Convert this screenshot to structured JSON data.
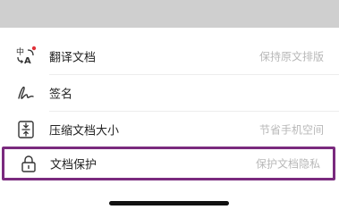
{
  "menu": {
    "items": [
      {
        "label": "翻译文档",
        "hint": "保持原文排版",
        "icon": "translate-icon",
        "badge_color": "#e0323a"
      },
      {
        "label": "签名",
        "hint": "",
        "icon": "signature-icon"
      },
      {
        "label": "压缩文档大小",
        "hint": "节省手机空间",
        "icon": "compress-icon"
      },
      {
        "label": "文档保护",
        "hint": "保护文档隐私",
        "icon": "lock-icon",
        "selected": true
      }
    ]
  },
  "colors": {
    "selection_border": "#7a2a7e",
    "hint_text": "#b8b8b8",
    "label_text": "#222222"
  }
}
